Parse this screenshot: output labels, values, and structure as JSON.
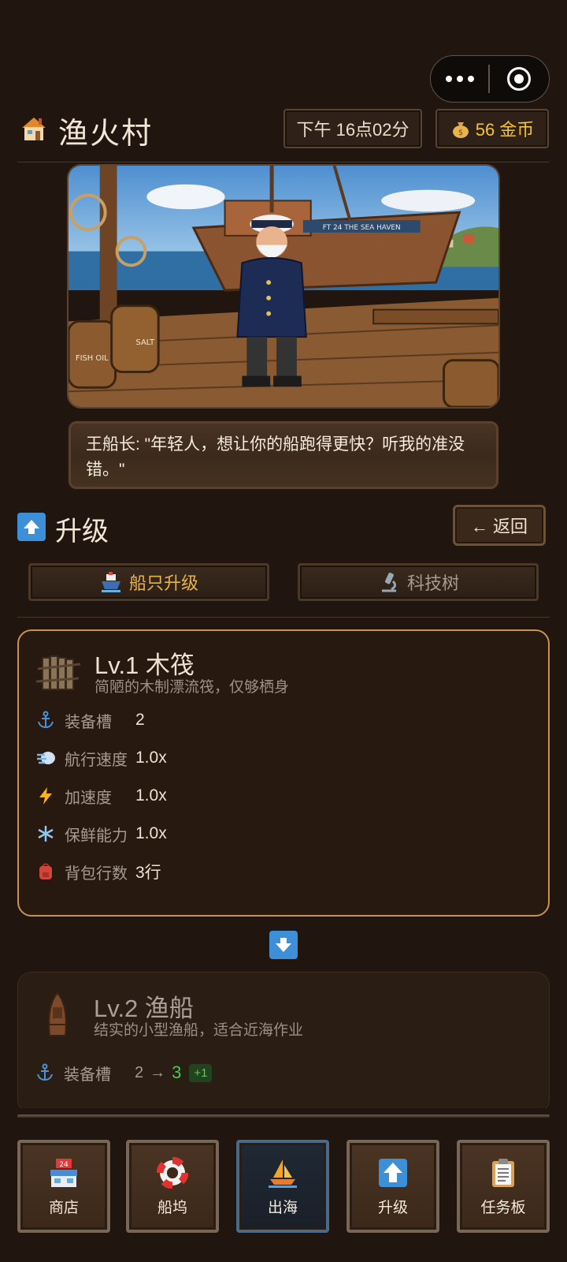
{
  "header": {
    "village_name": "渔火村",
    "time": "下午 16点02分",
    "coins_text": "56 金币"
  },
  "dialog": {
    "text": "王船长: \"年轻人，想让你的船跑得更快？听我的准没错。\""
  },
  "upgrade": {
    "title": "升级",
    "back_label": "← 返回",
    "tabs": [
      {
        "label": "船只升级",
        "icon": "ship-icon",
        "active": true
      },
      {
        "label": "科技树",
        "icon": "microscope-icon",
        "active": false
      }
    ]
  },
  "current_ship": {
    "title": "Lv.1 木筏",
    "desc": "简陋的木制漂流筏，仅够栖身",
    "stats": [
      {
        "icon": "anchor-icon",
        "label": "装备槽",
        "value": "2"
      },
      {
        "icon": "wind-icon",
        "label": "航行速度",
        "value": "1.0x"
      },
      {
        "icon": "lightning-icon",
        "label": "加速度",
        "value": "1.0x"
      },
      {
        "icon": "snowflake-icon",
        "label": "保鲜能力",
        "value": "1.0x"
      },
      {
        "icon": "backpack-icon",
        "label": "背包行数",
        "value": "3行"
      }
    ]
  },
  "next_ship": {
    "title": "Lv.2 渔船",
    "desc": "结实的小型渔船，适合近海作业",
    "stats": [
      {
        "icon": "anchor-icon",
        "label": "装备槽",
        "from": "2",
        "arrow": "→",
        "to": "3",
        "delta": "+1"
      }
    ]
  },
  "nav": [
    {
      "label": "商店",
      "icon": "store-icon"
    },
    {
      "label": "船坞",
      "icon": "lifebuoy-icon"
    },
    {
      "label": "出海",
      "icon": "sailboat-icon",
      "active": true
    },
    {
      "label": "升级",
      "icon": "up-arrow-icon"
    },
    {
      "label": "任务板",
      "icon": "clipboard-icon"
    }
  ],
  "colors": {
    "background": "#21160f",
    "gold": "#f3c33a",
    "accent_border": "#c9924e",
    "blue_icon": "#3d8fd8",
    "green": "#3fcf55"
  }
}
